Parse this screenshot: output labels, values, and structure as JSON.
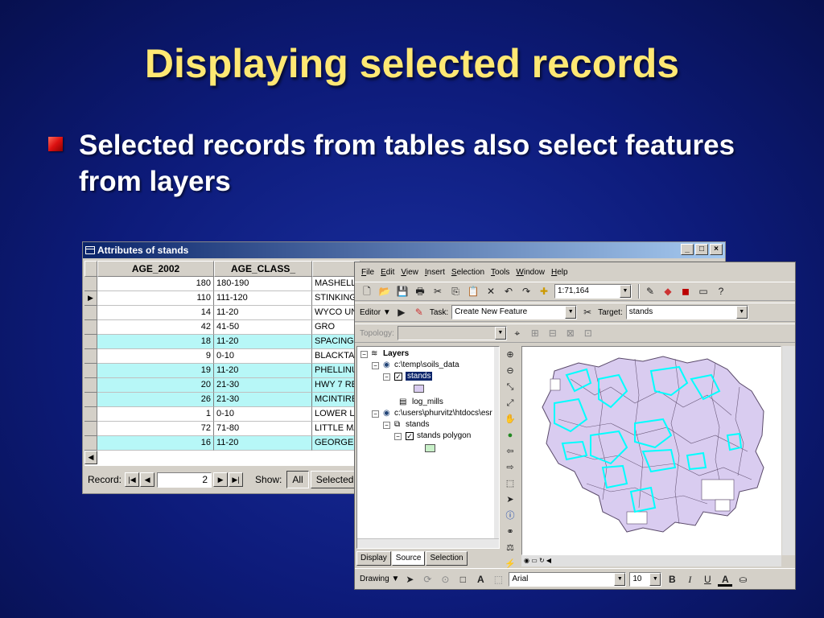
{
  "slide": {
    "title": "Displaying selected records",
    "bullet": "Selected records from tables also select features from layers"
  },
  "colors": {
    "title": "#ffe873",
    "background": "#0d1b7a",
    "bullet": "#d11111",
    "selected_row": "#b7f7f7",
    "selected_feature": "#00ffff",
    "polygon_fill": "#d9ccf0"
  },
  "attr_window": {
    "title": "Attributes of stands",
    "columns": [
      "AGE_2002",
      "AGE_CLASS_"
    ],
    "rows": [
      {
        "age_2002": "180",
        "age_class": "180-190",
        "name": "MASHELL",
        "selected": false,
        "marker": ""
      },
      {
        "age_2002": "110",
        "age_class": "111-120",
        "name": "STINKING",
        "selected": false,
        "marker": "▶"
      },
      {
        "age_2002": "14",
        "age_class": "11-20",
        "name": "WYCO UN",
        "selected": false,
        "marker": ""
      },
      {
        "age_2002": "42",
        "age_class": "41-50",
        "name": "GRO",
        "selected": false,
        "marker": ""
      },
      {
        "age_2002": "18",
        "age_class": "11-20",
        "name": "SPACING",
        "selected": true,
        "marker": ""
      },
      {
        "age_2002": "9",
        "age_class": "0-10",
        "name": "BLACKTA",
        "selected": false,
        "marker": ""
      },
      {
        "age_2002": "19",
        "age_class": "11-20",
        "name": "PHELLINUS",
        "selected": true,
        "marker": ""
      },
      {
        "age_2002": "20",
        "age_class": "21-30",
        "name": "HWY 7 RE",
        "selected": true,
        "marker": ""
      },
      {
        "age_2002": "26",
        "age_class": "21-30",
        "name": "MCINTIRE",
        "selected": true,
        "marker": ""
      },
      {
        "age_2002": "1",
        "age_class": "0-10",
        "name": "LOWER LI",
        "selected": false,
        "marker": ""
      },
      {
        "age_2002": "72",
        "age_class": "71-80",
        "name": "LITTLE MA",
        "selected": false,
        "marker": ""
      },
      {
        "age_2002": "16",
        "age_class": "11-20",
        "name": "GEORGES",
        "selected": true,
        "marker": ""
      }
    ],
    "record_label": "Record:",
    "record_value": "2",
    "show_label": "Show:",
    "all_label": "All",
    "selected_label": "Selected",
    "rec_trunc": "R"
  },
  "arcmap": {
    "menus": [
      "File",
      "Edit",
      "View",
      "Insert",
      "Selection",
      "Tools",
      "Window",
      "Help"
    ],
    "scale": "1:71,164",
    "editor_label": "Editor ▼",
    "task_label": "Task:",
    "task_value": "Create New Feature",
    "target_label": "Target:",
    "target_value": "stands",
    "topology_label": "Topology:",
    "toc": {
      "root": "Layers",
      "df1": "c:\\temp\\soils_data",
      "layer_stands": "stands",
      "table_log_mills": "log_mills",
      "df2": "c:\\users\\phurvitz\\htdocs\\esr",
      "layer_stands2": "stands",
      "layer_stands_polygon": "stands polygon"
    },
    "tabs": [
      "Display",
      "Source",
      "Selection"
    ],
    "drawing_label": "Drawing ▼",
    "font_name": "Arial",
    "font_size": "10",
    "bold_label": "B",
    "italic_label": "I",
    "underline_label": "U"
  }
}
